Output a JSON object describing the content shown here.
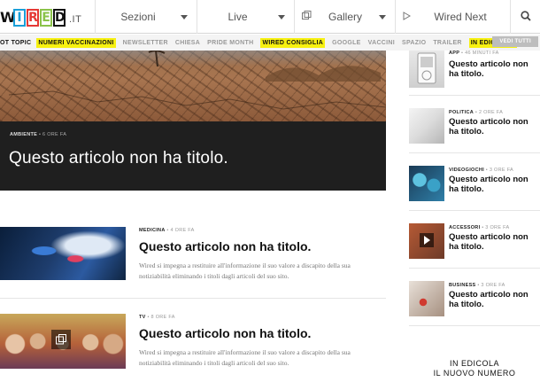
{
  "logo": {
    "letters": [
      "W",
      "I",
      "R",
      "E",
      "D"
    ],
    "suffix": ".IT",
    "colors": [
      "#111111",
      "#1a9fd8",
      "#e53935",
      "#8bc34a",
      "#111111"
    ]
  },
  "nav": {
    "sections_label": "Sezioni",
    "live_label": "Live",
    "gallery_label": "Gallery",
    "wired_next_label": "Wired Next",
    "icons": {
      "gallery": "gallery-icon",
      "wired_next": "play-icon",
      "search": "search-icon"
    }
  },
  "topics": {
    "lead": "OT TOPIC",
    "items": [
      {
        "label": "NUMERI VACCINAZIONI",
        "highlight": true
      },
      {
        "label": "NEWSLETTER",
        "highlight": false
      },
      {
        "label": "CHIESA",
        "highlight": false
      },
      {
        "label": "PRIDE MONTH",
        "highlight": false
      },
      {
        "label": "WIRED CONSIGLIA",
        "highlight": true
      },
      {
        "label": "GOOGLE",
        "highlight": false
      },
      {
        "label": "VACCINI",
        "highlight": false
      },
      {
        "label": "SPAZIO",
        "highlight": false
      },
      {
        "label": "TRAILER",
        "highlight": false
      },
      {
        "label": "IN EDICOLA...",
        "highlight": true
      }
    ],
    "see_all": "VEDI TUTTI",
    "highlight_color": "#f7f111"
  },
  "hero": {
    "category": "AMBIENTE",
    "time": " • 6 ORE FA",
    "title": "Questo articolo non ha titolo."
  },
  "articles": [
    {
      "category": "MEDICINA",
      "time": " • 4 ORE FA",
      "title": "Questo articolo non ha titolo.",
      "excerpt": "Wired si impegna a restituire all'informazione il suo valore a discapito della sua notiziabilità eliminando i titoli dagli articoli del suo sito."
    },
    {
      "category": "TV",
      "time": " • 8 ORE FA",
      "title": "Questo articolo non ha titolo.",
      "excerpt": "Wired si impegna a restituire all'informazione il suo valore a discapito della sua notiziabilità eliminando i titoli dagli articoli del suo sito."
    }
  ],
  "sidebar": {
    "items": [
      {
        "category": "APP",
        "time": " • 46 MINUTI FA",
        "title": "Questo articolo non ha titolo."
      },
      {
        "category": "POLITICA",
        "time": " • 2 ORE FA",
        "title": "Questo articolo non ha titolo."
      },
      {
        "category": "VIDEOGIOCHI",
        "time": " • 3 ORE FA",
        "title": "Questo articolo non ha titolo."
      },
      {
        "category": "ACCESSORI",
        "time": " • 3 ORE FA",
        "title": "Questo articolo non ha titolo."
      },
      {
        "category": "BUSINESS",
        "time": " • 3 ORE FA",
        "title": "Questo articolo non ha titolo."
      }
    ],
    "edicola_line1": "IN EDICOLA",
    "edicola_line2": "IL NUOVO NUMERO"
  }
}
